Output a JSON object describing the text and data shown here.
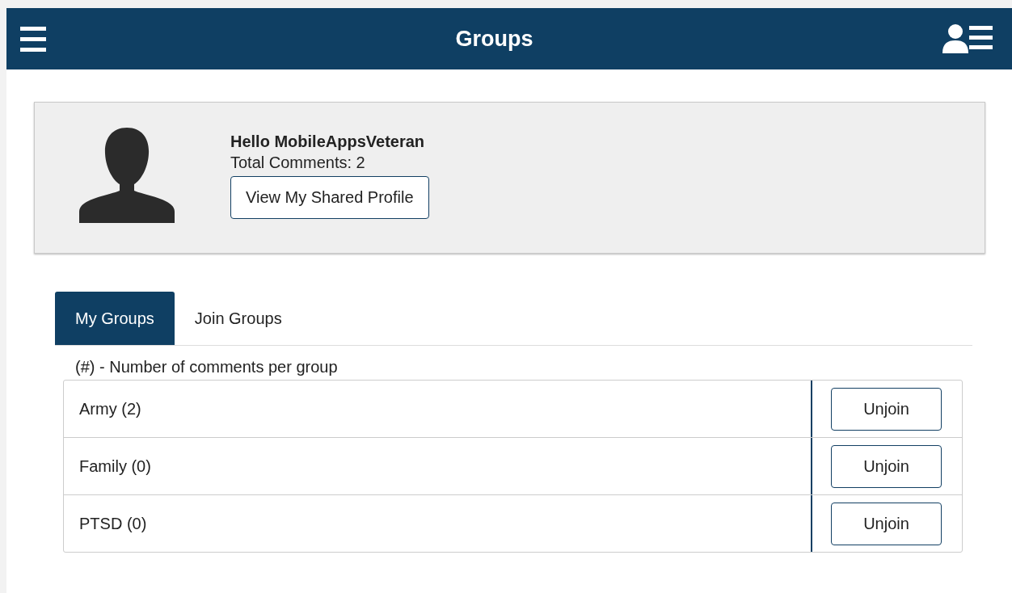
{
  "header": {
    "title": "Groups"
  },
  "profile": {
    "greeting": "Hello MobileAppsVeteran",
    "total_comments": "Total Comments: 2",
    "button": "View My Shared Profile"
  },
  "tabs": [
    {
      "label": "My Groups",
      "selected": true
    },
    {
      "label": "Join Groups",
      "selected": false
    }
  ],
  "legend": "(#) - Number of comments per group",
  "groups": [
    {
      "name": "Army (2)",
      "action": "Unjoin"
    },
    {
      "name": "Family (0)",
      "action": "Unjoin"
    },
    {
      "name": "PTSD (0)",
      "action": "Unjoin"
    }
  ]
}
